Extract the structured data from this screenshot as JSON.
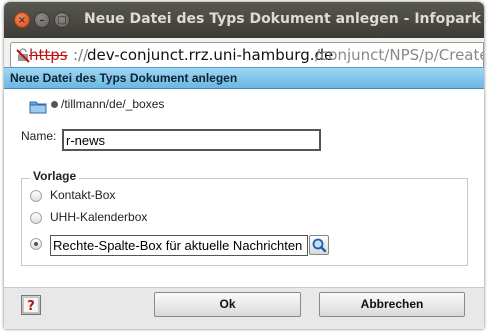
{
  "window": {
    "title": "Neue Datei des Typs Dokument anlegen - Infopark",
    "close_glyph": "×",
    "minimize_glyph": "–",
    "maximize_glyph": "□"
  },
  "urlbar": {
    "scheme": "https",
    "separator": "://",
    "host": "dev-conjunct.rrz.uni-hamburg.de",
    "path": "/conjunct/NPS/p/CreateO",
    "icon": "broken-lock-icon"
  },
  "dialog": {
    "header": "Neue Datei des Typs Dokument anlegen",
    "path": "/tillmann/de/_boxes",
    "name_label": "Name:",
    "name_value": "r-news",
    "group_label": "Vorlage",
    "options": [
      {
        "label": "Kontakt-Box",
        "checked": false
      },
      {
        "label": "UHH-Kalenderbox",
        "checked": false
      },
      {
        "label": "Rechte-Spalte-Box für aktuelle Nachrichten",
        "checked": true
      }
    ]
  },
  "footer": {
    "ok_label": "Ok",
    "cancel_label": "Abbrechen",
    "help_icon": "help-icon"
  },
  "colors": {
    "header_bg": "#7fc3ea",
    "titlebar_bg": "#3c3b37",
    "scheme_red": "#c01010"
  }
}
